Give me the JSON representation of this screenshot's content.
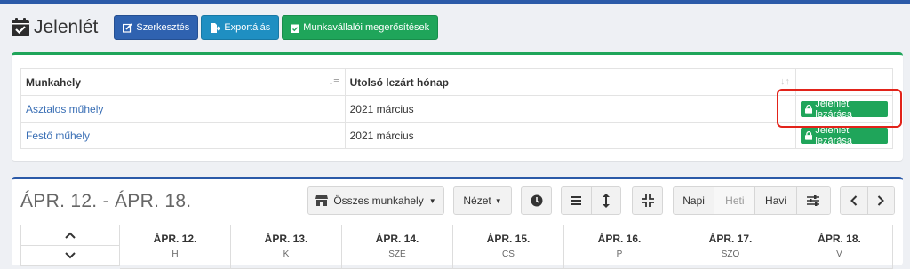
{
  "page": {
    "title": "Jelenlét",
    "buttons": {
      "edit": "Szerkesztés",
      "export": "Exportálás",
      "confirmations": "Munkavállalói megerősítések"
    }
  },
  "workplaces": {
    "headers": {
      "workplace": "Munkahely",
      "last_closed": "Utolsó lezárt hónap"
    },
    "rows": [
      {
        "name": "Asztalos műhely",
        "month": "2021 március",
        "action": "Jelenlét lezárása"
      },
      {
        "name": "Festő műhely",
        "month": "2021 március",
        "action": "Jelenlét lezárása"
      }
    ]
  },
  "calendar": {
    "range": "ÁPR. 12. - ÁPR. 18.",
    "filter": "Összes munkahely",
    "view": "Nézet",
    "modes": [
      "Napi",
      "Heti",
      "Havi"
    ],
    "days": [
      {
        "date": "ÁPR. 12.",
        "abbr": "H"
      },
      {
        "date": "ÁPR. 13.",
        "abbr": "K"
      },
      {
        "date": "ÁPR. 14.",
        "abbr": "SZE"
      },
      {
        "date": "ÁPR. 15.",
        "abbr": "CS"
      },
      {
        "date": "ÁPR. 16.",
        "abbr": "P"
      },
      {
        "date": "ÁPR. 17.",
        "abbr": "SZO"
      },
      {
        "date": "ÁPR. 18.",
        "abbr": "V"
      }
    ]
  },
  "colors": {
    "primary": "#2f62b0",
    "info": "#1f8fc2",
    "success": "#1fa55a",
    "highlight": "#e2231a"
  }
}
